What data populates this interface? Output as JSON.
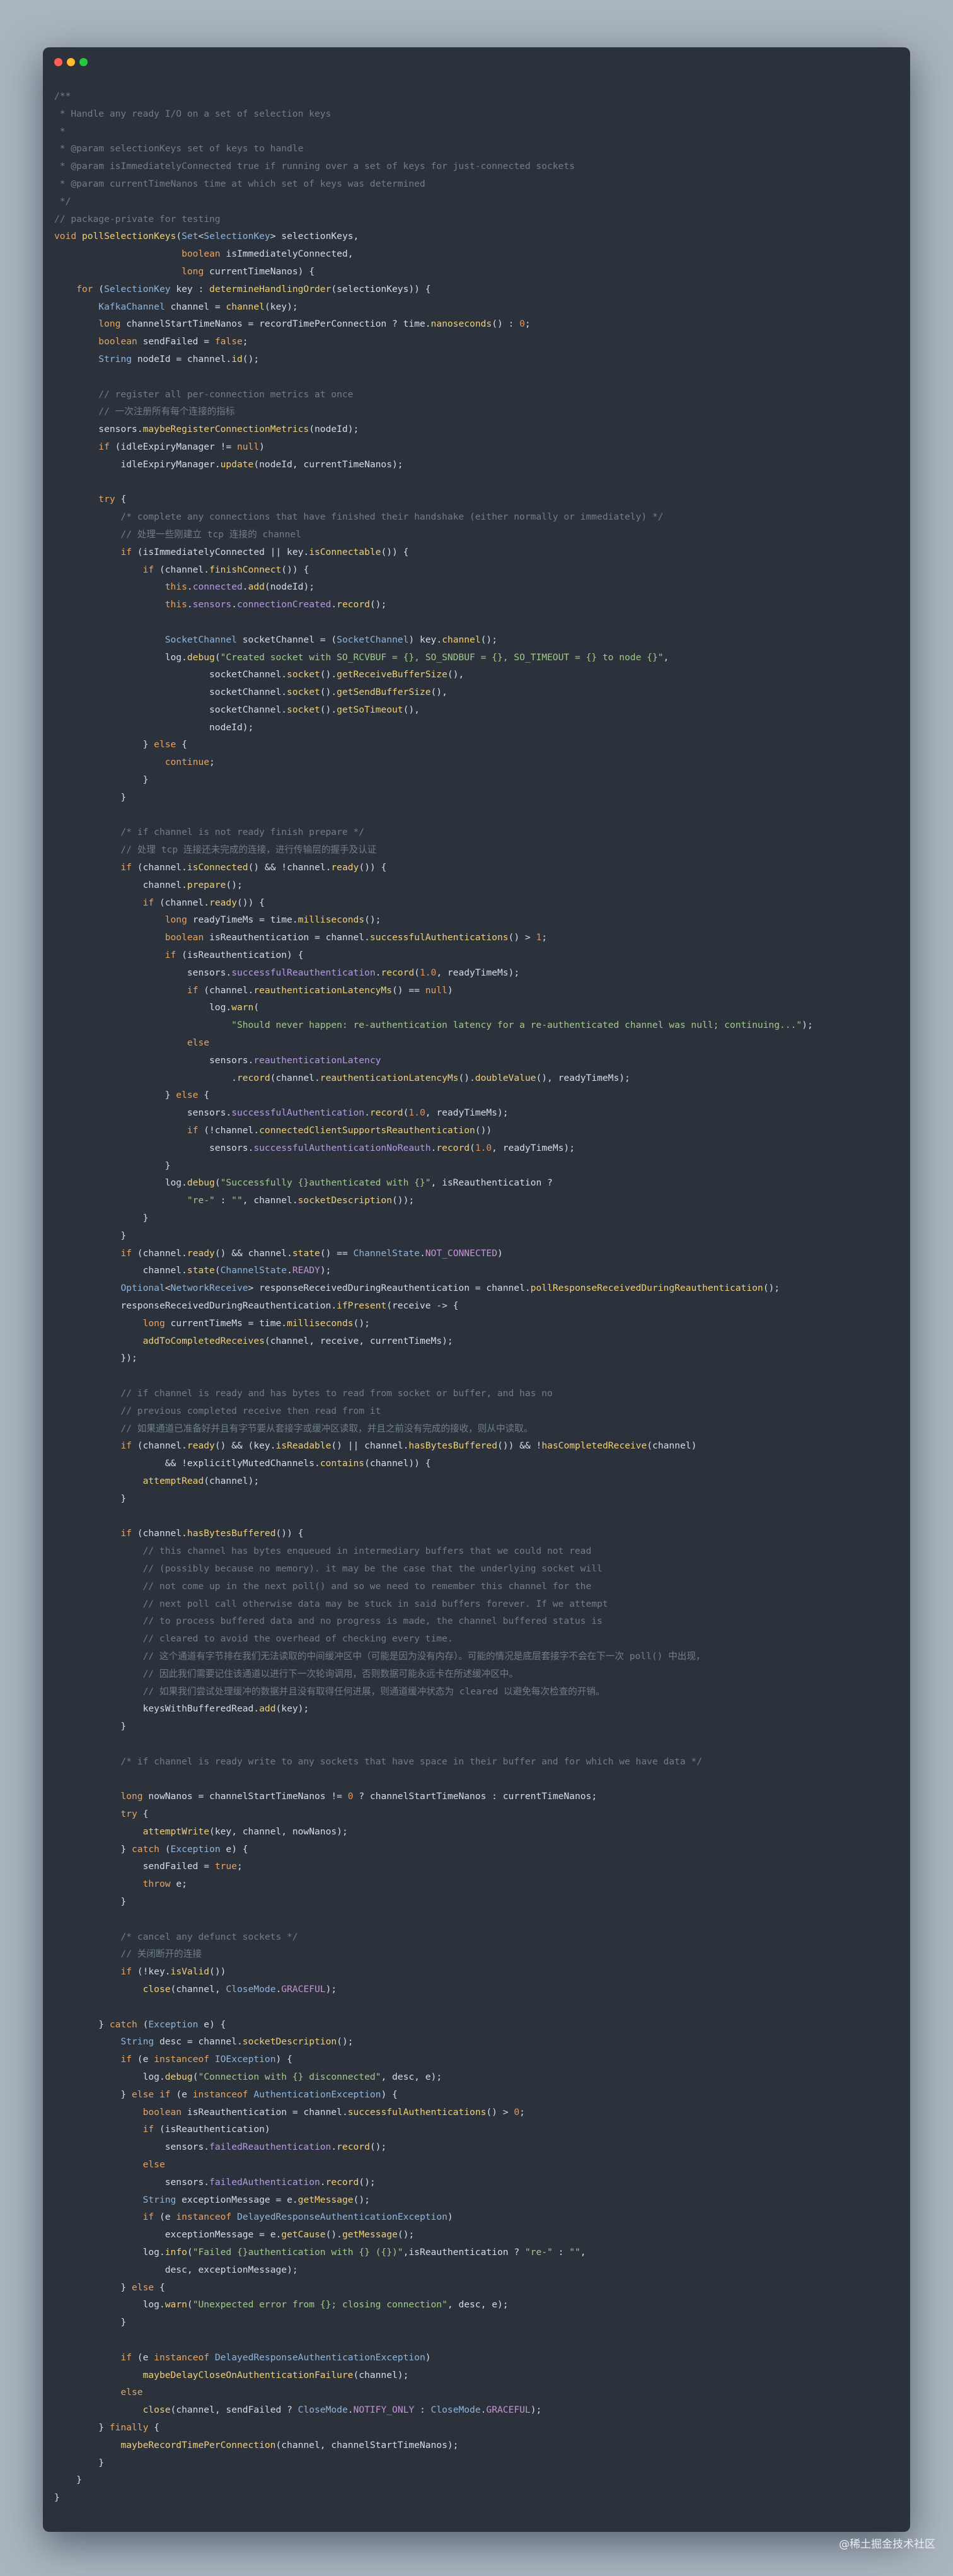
{
  "window": {
    "title_buttons": [
      "close",
      "minimize",
      "zoom"
    ]
  },
  "colors": {
    "background": "#a9b4bf",
    "editor": "#2b323b",
    "comment": "#6f7e8c",
    "keyword": "#e7a463",
    "string": "#a3c98a",
    "type": "#8fb4dc",
    "method": "#f0cf78",
    "field": "#b59be2"
  },
  "code": {
    "lines": [
      "/**",
      " * Handle any ready I/O on a set of selection keys",
      " *",
      " * @param selectionKeys set of keys to handle",
      " * @param isImmediatelyConnected true if running over a set of keys for just-connected sockets",
      " * @param currentTimeNanos time at which set of keys was determined",
      " */",
      "// package-private for testing",
      "void pollSelectionKeys(Set<SelectionKey> selectionKeys,",
      "                       boolean isImmediatelyConnected,",
      "                       long currentTimeNanos) {",
      "    for (SelectionKey key : determineHandlingOrder(selectionKeys)) {",
      "        KafkaChannel channel = channel(key);",
      "        long channelStartTimeNanos = recordTimePerConnection ? time.nanoseconds() : 0;",
      "        boolean sendFailed = false;",
      "        String nodeId = channel.id();",
      "",
      "        // register all per-connection metrics at once",
      "        // 一次注册所有每个连接的指标",
      "        sensors.maybeRegisterConnectionMetrics(nodeId);",
      "        if (idleExpiryManager != null)",
      "            idleExpiryManager.update(nodeId, currentTimeNanos);",
      "",
      "        try {",
      "            /* complete any connections that have finished their handshake (either normally or immediately) */",
      "            // 处理一些刚建立 tcp 连接的 channel",
      "            if (isImmediatelyConnected || key.isConnectable()) {",
      "                if (channel.finishConnect()) {",
      "                    this.connected.add(nodeId);",
      "                    this.sensors.connectionCreated.record();",
      "",
      "                    SocketChannel socketChannel = (SocketChannel) key.channel();",
      "                    log.debug(\"Created socket with SO_RCVBUF = {}, SO_SNDBUF = {}, SO_TIMEOUT = {} to node {}\",",
      "                            socketChannel.socket().getReceiveBufferSize(),",
      "                            socketChannel.socket().getSendBufferSize(),",
      "                            socketChannel.socket().getSoTimeout(),",
      "                            nodeId);",
      "                } else {",
      "                    continue;",
      "                }",
      "            }",
      "",
      "            /* if channel is not ready finish prepare */",
      "            // 处理 tcp 连接还未完成的连接，进行传输层的握手及认证",
      "            if (channel.isConnected() && !channel.ready()) {",
      "                channel.prepare();",
      "                if (channel.ready()) {",
      "                    long readyTimeMs = time.milliseconds();",
      "                    boolean isReauthentication = channel.successfulAuthentications() > 1;",
      "                    if (isReauthentication) {",
      "                        sensors.successfulReauthentication.record(1.0, readyTimeMs);",
      "                        if (channel.reauthenticationLatencyMs() == null)",
      "                            log.warn(",
      "                                \"Should never happen: re-authentication latency for a re-authenticated channel was null; continuing...\");",
      "                        else",
      "                            sensors.reauthenticationLatency",
      "                                .record(channel.reauthenticationLatencyMs().doubleValue(), readyTimeMs);",
      "                    } else {",
      "                        sensors.successfulAuthentication.record(1.0, readyTimeMs);",
      "                        if (!channel.connectedClientSupportsReauthentication())",
      "                            sensors.successfulAuthenticationNoReauth.record(1.0, readyTimeMs);",
      "                    }",
      "                    log.debug(\"Successfully {}authenticated with {}\", isReauthentication ?",
      "                        \"re-\" : \"\", channel.socketDescription());",
      "                }",
      "            }",
      "            if (channel.ready() && channel.state() == ChannelState.NOT_CONNECTED)",
      "                channel.state(ChannelState.READY);",
      "            Optional<NetworkReceive> responseReceivedDuringReauthentication = channel.pollResponseReceivedDuringReauthentication();",
      "            responseReceivedDuringReauthentication.ifPresent(receive -> {",
      "                long currentTimeMs = time.milliseconds();",
      "                addToCompletedReceives(channel, receive, currentTimeMs);",
      "            });",
      "",
      "            // if channel is ready and has bytes to read from socket or buffer, and has no",
      "            // previous completed receive then read from it",
      "            // 如果通道已准备好并且有字节要从套接字或缓冲区读取，并且之前没有完成的接收，则从中读取。",
      "            if (channel.ready() && (key.isReadable() || channel.hasBytesBuffered()) && !hasCompletedReceive(channel)",
      "                    && !explicitlyMutedChannels.contains(channel)) {",
      "                attemptRead(channel);",
      "            }",
      "",
      "            if (channel.hasBytesBuffered()) {",
      "                // this channel has bytes enqueued in intermediary buffers that we could not read",
      "                // (possibly because no memory). it may be the case that the underlying socket will",
      "                // not come up in the next poll() and so we need to remember this channel for the",
      "                // next poll call otherwise data may be stuck in said buffers forever. If we attempt",
      "                // to process buffered data and no progress is made, the channel buffered status is",
      "                // cleared to avoid the overhead of checking every time.",
      "                // 这个通道有字节排在我们无法读取的中间缓冲区中（可能是因为没有内存）。可能的情况是底层套接字不会在下一次 poll() 中出现，",
      "                // 因此我们需要记住该通道以进行下一次轮询调用，否则数据可能永远卡在所述缓冲区中。",
      "                // 如果我们尝试处理缓冲的数据并且没有取得任何进展，则通道缓冲状态为 cleared 以避免每次检查的开销。",
      "                keysWithBufferedRead.add(key);",
      "            }",
      "",
      "            /* if channel is ready write to any sockets that have space in their buffer and for which we have data */",
      "",
      "            long nowNanos = channelStartTimeNanos != 0 ? channelStartTimeNanos : currentTimeNanos;",
      "            try {",
      "                attemptWrite(key, channel, nowNanos);",
      "            } catch (Exception e) {",
      "                sendFailed = true;",
      "                throw e;",
      "            }",
      "",
      "            /* cancel any defunct sockets */",
      "            // 关闭断开的连接",
      "            if (!key.isValid())",
      "                close(channel, CloseMode.GRACEFUL);",
      "",
      "        } catch (Exception e) {",
      "            String desc = channel.socketDescription();",
      "            if (e instanceof IOException) {",
      "                log.debug(\"Connection with {} disconnected\", desc, e);",
      "            } else if (e instanceof AuthenticationException) {",
      "                boolean isReauthentication = channel.successfulAuthentications() > 0;",
      "                if (isReauthentication)",
      "                    sensors.failedReauthentication.record();",
      "                else",
      "                    sensors.failedAuthentication.record();",
      "                String exceptionMessage = e.getMessage();",
      "                if (e instanceof DelayedResponseAuthenticationException)",
      "                    exceptionMessage = e.getCause().getMessage();",
      "                log.info(\"Failed {}authentication with {} ({})\",isReauthentication ? \"re-\" : \"\",",
      "                    desc, exceptionMessage);",
      "            } else {",
      "                log.warn(\"Unexpected error from {}; closing connection\", desc, e);",
      "            }",
      "",
      "            if (e instanceof DelayedResponseAuthenticationException)",
      "                maybeDelayCloseOnAuthenticationFailure(channel);",
      "            else",
      "                close(channel, sendFailed ? CloseMode.NOTIFY_ONLY : CloseMode.GRACEFUL);",
      "        } finally {",
      "            maybeRecordTimePerConnection(channel, channelStartTimeNanos);",
      "        }",
      "    }",
      "}"
    ]
  },
  "watermark": {
    "text": "@稀土掘金技术社区"
  }
}
